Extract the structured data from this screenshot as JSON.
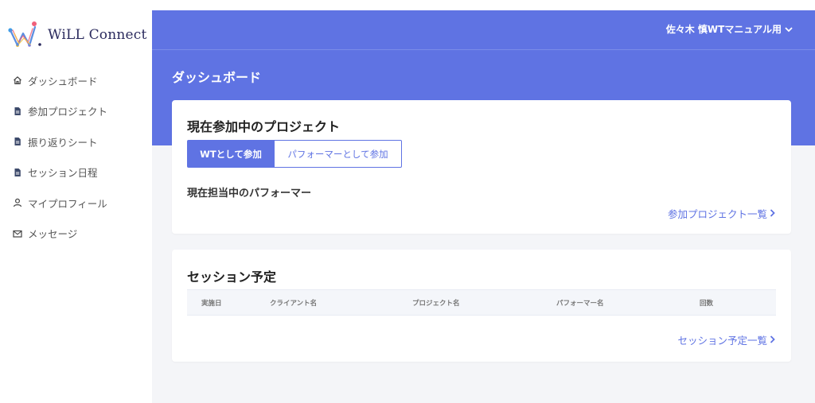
{
  "app": {
    "logo_text": "WiLL Connect",
    "accent_color": "#5f73e3"
  },
  "sidebar": {
    "items": [
      {
        "label": "ダッシュボード",
        "icon": "home-icon"
      },
      {
        "label": "参加プロジェクト",
        "icon": "document-icon"
      },
      {
        "label": "振り返りシート",
        "icon": "document-icon"
      },
      {
        "label": "セッション日程",
        "icon": "document-icon"
      },
      {
        "label": "マイプロフィール",
        "icon": "user-icon"
      },
      {
        "label": "メッセージ",
        "icon": "mail-icon"
      }
    ]
  },
  "header": {
    "user_name": "佐々木 慎WTマニュアル用",
    "page_title": "ダッシュボード"
  },
  "projects_card": {
    "title": "現在参加中のプロジェクト",
    "tabs": [
      {
        "label": "WTとして参加",
        "active": true
      },
      {
        "label": "パフォーマーとして参加",
        "active": false
      }
    ],
    "sub_title": "現在担当中のパフォーマー",
    "link_label": "参加プロジェクト一覧"
  },
  "sessions_card": {
    "title": "セッション予定",
    "columns": [
      "実施日",
      "クライアント名",
      "プロジェクト名",
      "パフォーマー名",
      "回数"
    ],
    "link_label": "セッション予定一覧"
  }
}
